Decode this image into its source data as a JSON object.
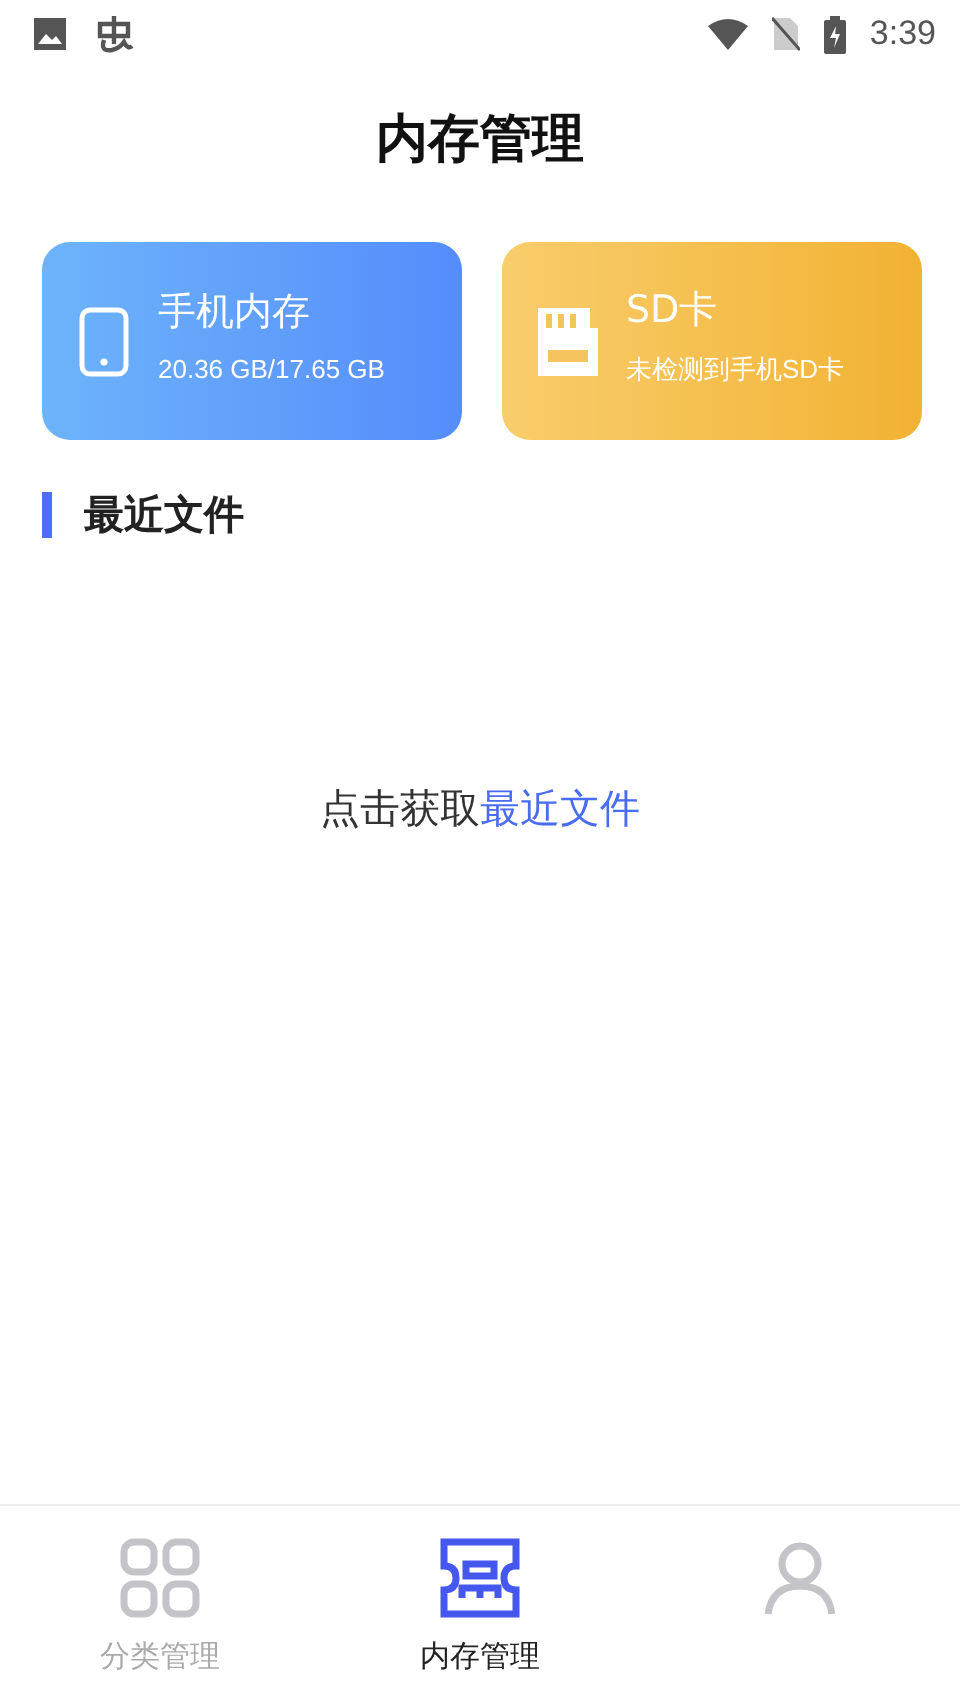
{
  "status_bar": {
    "time": "3:39"
  },
  "title": "内存管理",
  "cards": [
    {
      "kind": "phone",
      "title": "手机内存",
      "subtitle": "20.36 GB/17.65 GB"
    },
    {
      "kind": "sd",
      "title": "SD卡",
      "subtitle": "未检测到手机SD卡"
    }
  ],
  "section": {
    "title": "最近文件"
  },
  "empty_hint": {
    "text": "点击获取",
    "link": "最近文件"
  },
  "tabs": [
    {
      "kind": "grid",
      "label": "分类管理",
      "selected": false
    },
    {
      "kind": "storage",
      "label": "内存管理",
      "selected": true
    },
    {
      "kind": "person",
      "selected": false
    }
  ]
}
